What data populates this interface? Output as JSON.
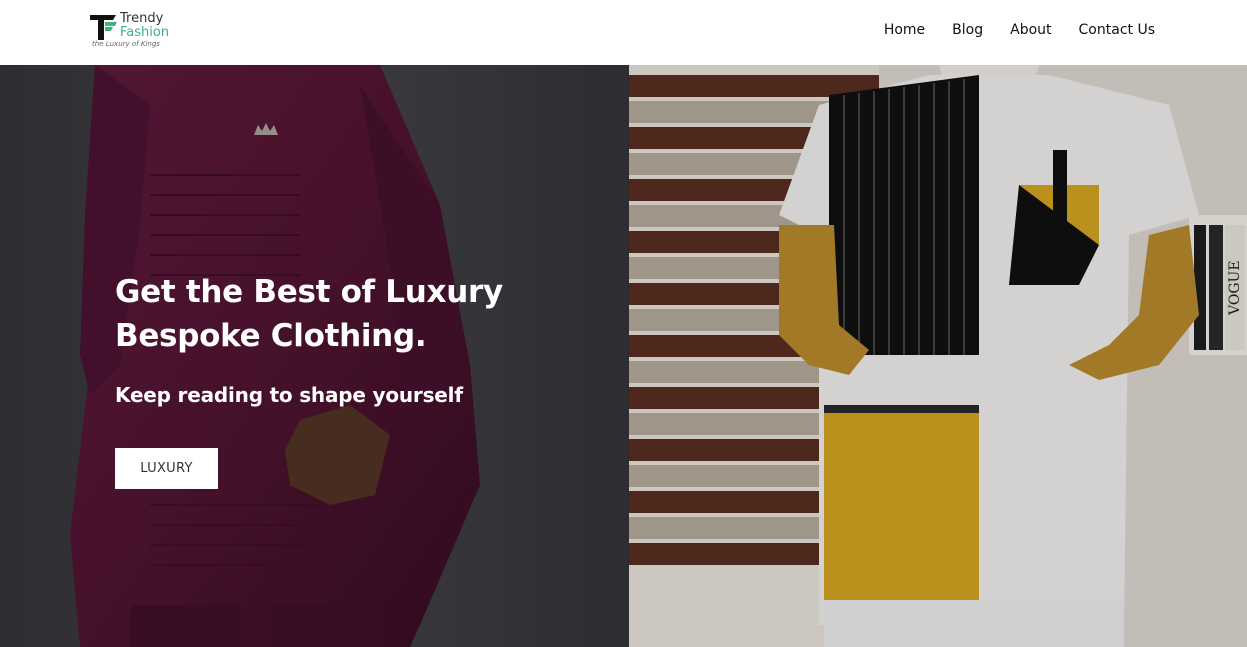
{
  "brand": {
    "word1": "Trendy",
    "word2": "Fashion",
    "tagline": "the Luxury of Kings",
    "accent": "#3fb27f"
  },
  "nav": {
    "items": [
      {
        "label": "Home"
      },
      {
        "label": "Blog"
      },
      {
        "label": "About"
      },
      {
        "label": "Contact Us"
      }
    ]
  },
  "hero": {
    "title": "Get the Best of Luxury Bespoke Clothing.",
    "subtitle": "Keep reading to shape yourself",
    "button_label": "LUXURY",
    "left_image": "burgundy-kaftan-photo",
    "right_image": "patchwork-shirt-mannequin-photo",
    "shelf_text": "VOGUE"
  }
}
